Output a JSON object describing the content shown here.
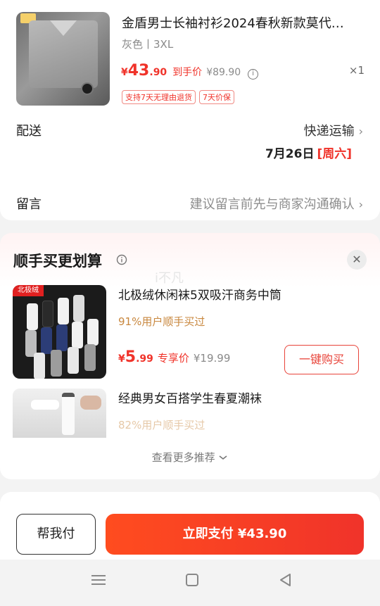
{
  "order_item": {
    "title": "金盾男士长袖衬衫2024春秋新款莫代…",
    "spec": "灰色丨3XL",
    "price_symbol": "¥",
    "price_int": "43",
    "price_dec": ".90",
    "price_tag": "到手价",
    "original_price": "¥89.90",
    "quantity": "×1",
    "badges": [
      "支持7天无理由退货",
      "7天价保"
    ]
  },
  "delivery": {
    "label": "配送",
    "method": "快递运输",
    "date": "7月26日",
    "weekday": "[周六]"
  },
  "message": {
    "label": "留言",
    "placeholder": "建议留言前先与商家沟通确认"
  },
  "upsell": {
    "title": "顺手买更划算",
    "watermark": "i不凡",
    "items": [
      {
        "name": "北极绒休闲袜5双吸汗商务中筒",
        "bought": "91%用户顺手买过",
        "price_symbol": "¥",
        "price_int": "5",
        "price_dec": ".99",
        "price_tag": "专享价",
        "original_price": "¥19.99",
        "button": "一键购买",
        "image_tag": "北极绒"
      },
      {
        "name": "经典男女百搭学生春夏潮袜",
        "bought": "82%用户顺手买过"
      }
    ],
    "more": "查看更多推荐"
  },
  "footer": {
    "help_pay": "帮我付",
    "pay_now": "立即支付 ¥43.90"
  },
  "colors": {
    "accent": "#f0332a",
    "gold": "#c8873e"
  }
}
